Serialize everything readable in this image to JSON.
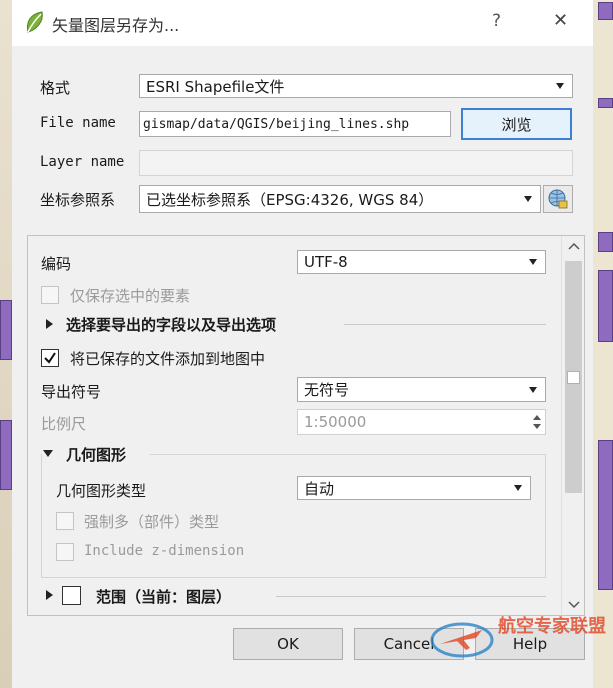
{
  "window": {
    "title": "矢量图层另存为...",
    "help_glyph": "?",
    "close_glyph": "✕"
  },
  "form": {
    "format_label": "格式",
    "format_value": "ESRI Shapefile文件",
    "filename_label": "File name",
    "filename_value": "gismap/data/QGIS/beijing_lines.shp",
    "browse_label": "浏览",
    "layername_label": "Layer name",
    "layername_value": "",
    "crs_label": "坐标参照系",
    "crs_value": "已选坐标参照系（EPSG:4326, WGS 84）"
  },
  "options": {
    "encoding_label": "编码",
    "encoding_value": "UTF-8",
    "selected_only_label": "仅保存选中的要素",
    "fields_section_label": "选择要导出的字段以及导出选项",
    "add_to_map_label": "将已保存的文件添加到地图中",
    "symbology_label": "导出符号",
    "symbology_value": "无符号",
    "scale_label": "比例尺",
    "scale_value": "1:50000",
    "geometry_section_label": "几何图形",
    "geometry_type_label": "几何图形类型",
    "geometry_type_value": "自动",
    "force_multi_label": "强制多（部件）类型",
    "include_z_label": "Include z-dimension",
    "extent_section_label": "范围（当前：图层）"
  },
  "buttons": {
    "ok": "OK",
    "cancel": "Cancel",
    "help": "Help"
  },
  "watermark": {
    "logo_text": "航空专家联盟"
  },
  "colors": {
    "accent": "#3c7fd6",
    "map_purple": "#8f6bc0",
    "qgis_green": "#7bb33a"
  }
}
